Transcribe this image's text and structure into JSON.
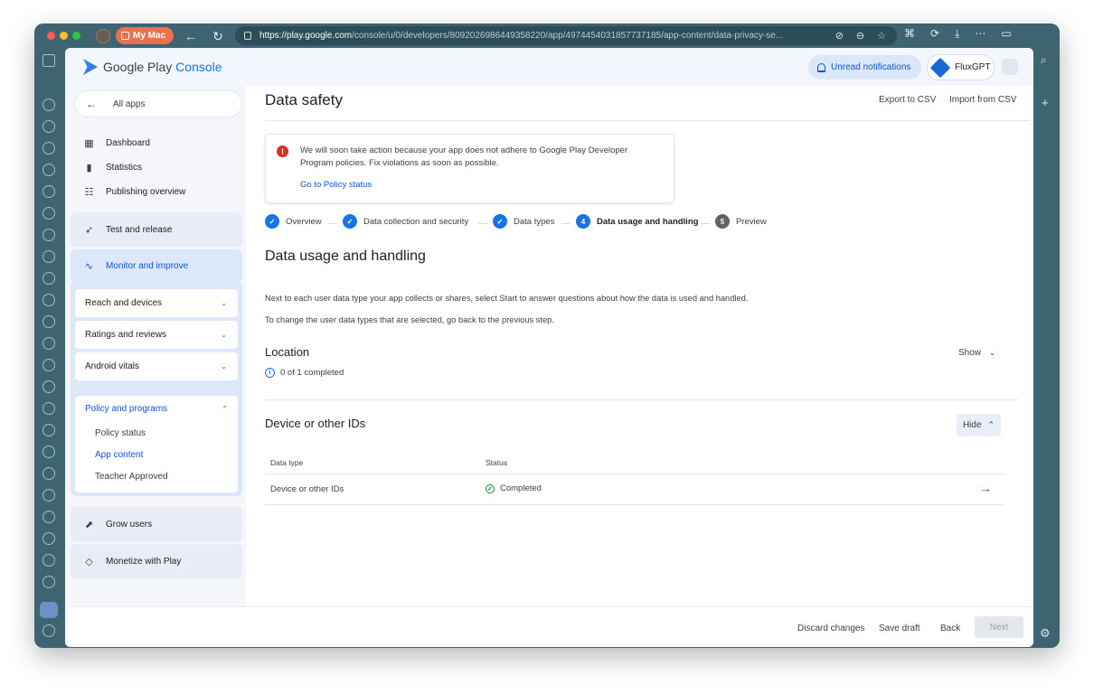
{
  "colors": {
    "window": "#3d6470",
    "accent_blue": "#1a73e8",
    "alert_red": "#d93025",
    "success_green": "#188038",
    "profile_orange": "#e9714c"
  },
  "browser": {
    "profile_name": "My Mac",
    "profile_icon": "mac-icon",
    "url_host": "https://play.google.com",
    "url_rest": "/console/u/0/developers/8092026986449358220/app/4974454031857737185/app-content/data-privacy-se...",
    "url_icons": [
      "extension-icon",
      "more-icon",
      "star-icon"
    ],
    "toolbar_icons": [
      "translate-icon",
      "sync-icon",
      "download-icon",
      "more-icon",
      "sidebar-icon"
    ]
  },
  "header": {
    "brand_left": "Google Play ",
    "brand_right": "Console",
    "notifications": "Unread notifications",
    "app_name": "FluxGPT"
  },
  "sidebar": {
    "all_apps": "All apps",
    "top_items": [
      {
        "label": "Dashboard",
        "icon": "dashboard-icon"
      },
      {
        "label": "Statistics",
        "icon": "bar-chart-icon"
      },
      {
        "label": "Publishing overview",
        "icon": "publish-icon"
      }
    ],
    "sections": [
      {
        "label": "Test and release",
        "icon": "rocket-icon"
      },
      {
        "label": "Monitor and improve",
        "icon": "pulse-icon"
      }
    ],
    "monitor_items": [
      "Reach and devices",
      "Ratings and reviews",
      "Android vitals"
    ],
    "policy": {
      "label": "Policy and programs",
      "items": [
        "Policy status",
        "App content",
        "Teacher Approved"
      ]
    },
    "bottom_sections": [
      {
        "label": "Grow users",
        "icon": "grow-icon"
      },
      {
        "label": "Monetize with Play",
        "icon": "tag-icon"
      }
    ]
  },
  "main": {
    "title": "Data safety",
    "export": "Export to CSV",
    "import": "Import from CSV",
    "alert": {
      "text": "We will soon take action because your app does not adhere to Google Play Developer Program policies. Fix violations as soon as possible.",
      "link": "Go to Policy status"
    },
    "steps": [
      {
        "label": "Overview",
        "status": "done",
        "number": ""
      },
      {
        "label": "Data collection and security",
        "status": "done",
        "number": ""
      },
      {
        "label": "Data types",
        "status": "done",
        "number": ""
      },
      {
        "label": "Data usage and handling",
        "status": "current",
        "number": "4"
      },
      {
        "label": "Preview",
        "status": "upcoming",
        "number": "5"
      }
    ],
    "section_title": "Data usage and handling",
    "instructions": "Next to each user data type your app collects or shares, select Start to answer questions about how the data is used and handled.",
    "hint": "To change the user data types that are selected, go back to the previous step.",
    "location": {
      "title": "Location",
      "toggle": "Show",
      "progress": "0 of 1 completed"
    },
    "device": {
      "title": "Device or other IDs",
      "toggle": "Hide",
      "columns": [
        "Data type",
        "Status"
      ],
      "rows": [
        {
          "type": "Device or other IDs",
          "status": "Completed"
        }
      ]
    }
  },
  "footer": {
    "discard": "Discard changes",
    "save": "Save draft",
    "back": "Back",
    "next": "Next"
  }
}
